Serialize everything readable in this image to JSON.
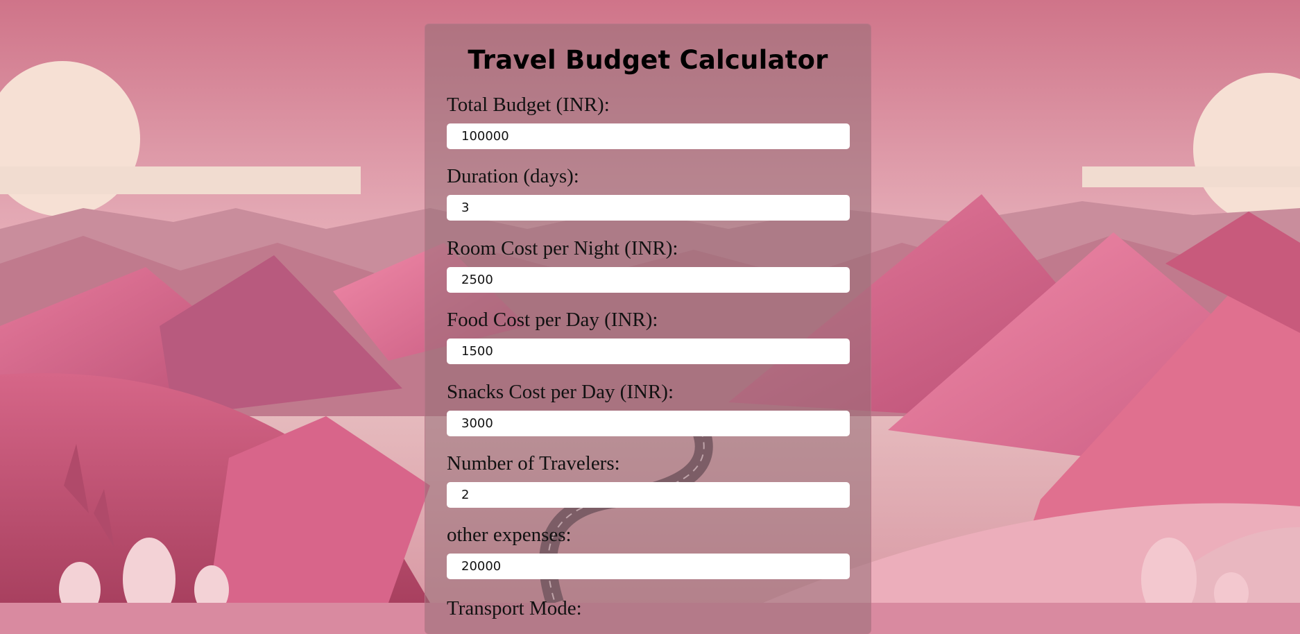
{
  "calculator": {
    "title": "Travel Budget Calculator",
    "fields": [
      {
        "label": "Total Budget (INR):",
        "value": "100000"
      },
      {
        "label": "Duration (days):",
        "value": "3"
      },
      {
        "label": "Room Cost per Night (INR):",
        "value": "2500"
      },
      {
        "label": "Food Cost per Day (INR):",
        "value": "1500"
      },
      {
        "label": "Snacks Cost per Day (INR):",
        "value": "3000"
      },
      {
        "label": "Number of Travelers:",
        "value": "2"
      },
      {
        "label": "other expenses:",
        "value": "20000"
      }
    ],
    "next_label_partial": "Transport Mode:"
  },
  "colors": {
    "background": "#d98aa0",
    "panel": "rgba(150,110,118,0.55)",
    "input": "#ffffff"
  }
}
